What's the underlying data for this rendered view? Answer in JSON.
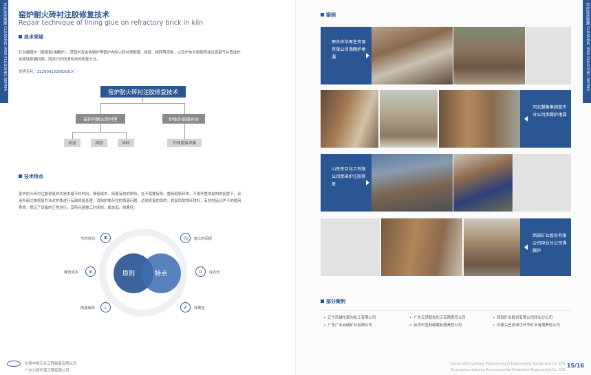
{
  "left_page": {
    "side_text": "清炉清洗堵漏 CLEANING AND PLUGGING REPAIR",
    "title_cn": "窑炉耐火砖衬注胶修复技术",
    "title_en": "Repair technique of lining glue on refractory brick in kiln",
    "section_field": "技术领域",
    "field_text_1": "针对烟煤炉（脱硫窑/沸腾炉），焚硫炉及余热锅炉等窑炉内耐火砖衬里剥落、掉层、掉砖等现象，以及炉体外部钢壳体出现串气并造成炉",
    "field_text_2": "体腐蚀穿漏问题，而进行的快速有效的修复方法。",
    "patent_label": "发明专利：",
    "patent_number": "ZL200910166208.X",
    "tree": {
      "root": "窑炉耐火砖衬注胶修复技术",
      "branch_left": "窑炉内耐火砖衬里",
      "branch_right": "炉体外部钢壳体",
      "leaves_left": [
        "剥落",
        "掉层",
        "掉砖"
      ],
      "leaf_right": "炉体腐蚀泄漏"
    },
    "section_features": "技术特点",
    "features_text_1": "窑炉耐火砖衬注胶修复技术是本着节约时间、降低成本、简便有效的原则，在不需要拆除、重新砌筑砖体，不损坏整体结构的前提下，采",
    "features_text_2": "用外部注胶修复方法对炉体进行有缺修复处理，消除炉体存在的隐患问题，达到修复的目的，修复后耐蚀环境好，有效地延长炉子的使用",
    "features_text_3": "寿命，保证了设备的正常运行，其特点是施工时间短，成本低，效果佳。",
    "features": {
      "center_left": "原则",
      "center_right": "特点",
      "items": [
        {
          "label": "节约时间",
          "icon": "hourglass-icon",
          "glyph": "⧗"
        },
        {
          "label": "降低成本",
          "icon": "money-icon",
          "glyph": "¥"
        },
        {
          "label": "简便有效",
          "icon": "flame-icon",
          "glyph": "♨"
        },
        {
          "label": "施工时间短",
          "icon": "clock-icon",
          "glyph": "◷"
        },
        {
          "label": "成本低",
          "icon": "coin-icon",
          "glyph": "¤"
        },
        {
          "label": "效果佳",
          "icon": "thumbs-up-icon",
          "glyph": "✔"
        }
      ]
    },
    "footer_co_1": "甘肃中晟石化工程装备有限公司",
    "footer_co_2": "广州力晟环保工程有限公司"
  },
  "right_page": {
    "side_text": "清炉清洗堵漏 CLEANING AND PLUGGING REPAIR",
    "section_cases": "案例",
    "cases": [
      {
        "label": "邢台庆华再生资源有限公司沸腾炉堵漏",
        "side": "left"
      },
      {
        "label": "河北冀衡集团蓝天分公司沸腾炉堵漏",
        "side": "right"
      },
      {
        "label": "山东东巨化工有限公司焚硫炉注胶修复",
        "side": "left"
      },
      {
        "label": "西部矿业股份有限公司锌业分公司沸腾炉",
        "side": "right"
      }
    ],
    "section_partial": "部分案例",
    "partial_cases": [
      "辽宁凤城东家沟化工有限公司",
      "广东云浮联发化工有限责任公司",
      "西部矿业股份有限公司锌业分公司",
      "广东广业云硫矿业有限公司",
      "云浮市宝利硫酸有限责任公司",
      "内蒙古巴彦淖尔开华矿业有限责任公司"
    ],
    "footer_en_1": "Gansu Zhongsheng Petrochemical Engineering Equipment Co. LTD.",
    "footer_en_2": "Guangzhou Lisheng Environmental Protection Engineering Co. LTD.",
    "page_numbers": "15/16"
  },
  "colors": {
    "brand": "#2b5694",
    "node_gray": "#8a8a8a",
    "leaf_gray": "#d4d4d4"
  }
}
